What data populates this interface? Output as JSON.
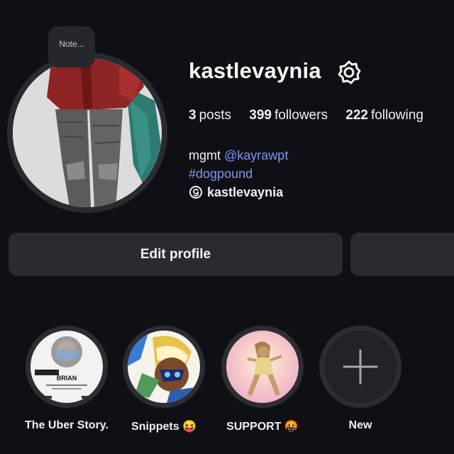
{
  "note": {
    "text": "Note..."
  },
  "profile": {
    "username": "kastlevaynia",
    "settings_icon": "gear-icon"
  },
  "stats": {
    "posts_count": "3",
    "posts_label": "posts",
    "followers_count": "399",
    "followers_label": "followers",
    "following_count": "222",
    "following_label": "following"
  },
  "bio": {
    "line1_prefix": "mgmt",
    "line1_mention": "@kayrawpt",
    "line2_hashtag": "#dogpound",
    "threads_handle": "kastlevaynia",
    "threads_icon": "threads-icon"
  },
  "buttons": {
    "edit_profile": "Edit profile"
  },
  "highlights": [
    {
      "label": "The Uber Story.",
      "cover_text": "BRIAN"
    },
    {
      "label": "Snippets 😝"
    },
    {
      "label": "SUPPORT 🤬"
    },
    {
      "label": "New",
      "icon": "plus-icon"
    }
  ],
  "colors": {
    "background": "#0f1015",
    "surface": "#2a2b30",
    "link": "#7c97f5",
    "text": "#f5f5f5"
  }
}
